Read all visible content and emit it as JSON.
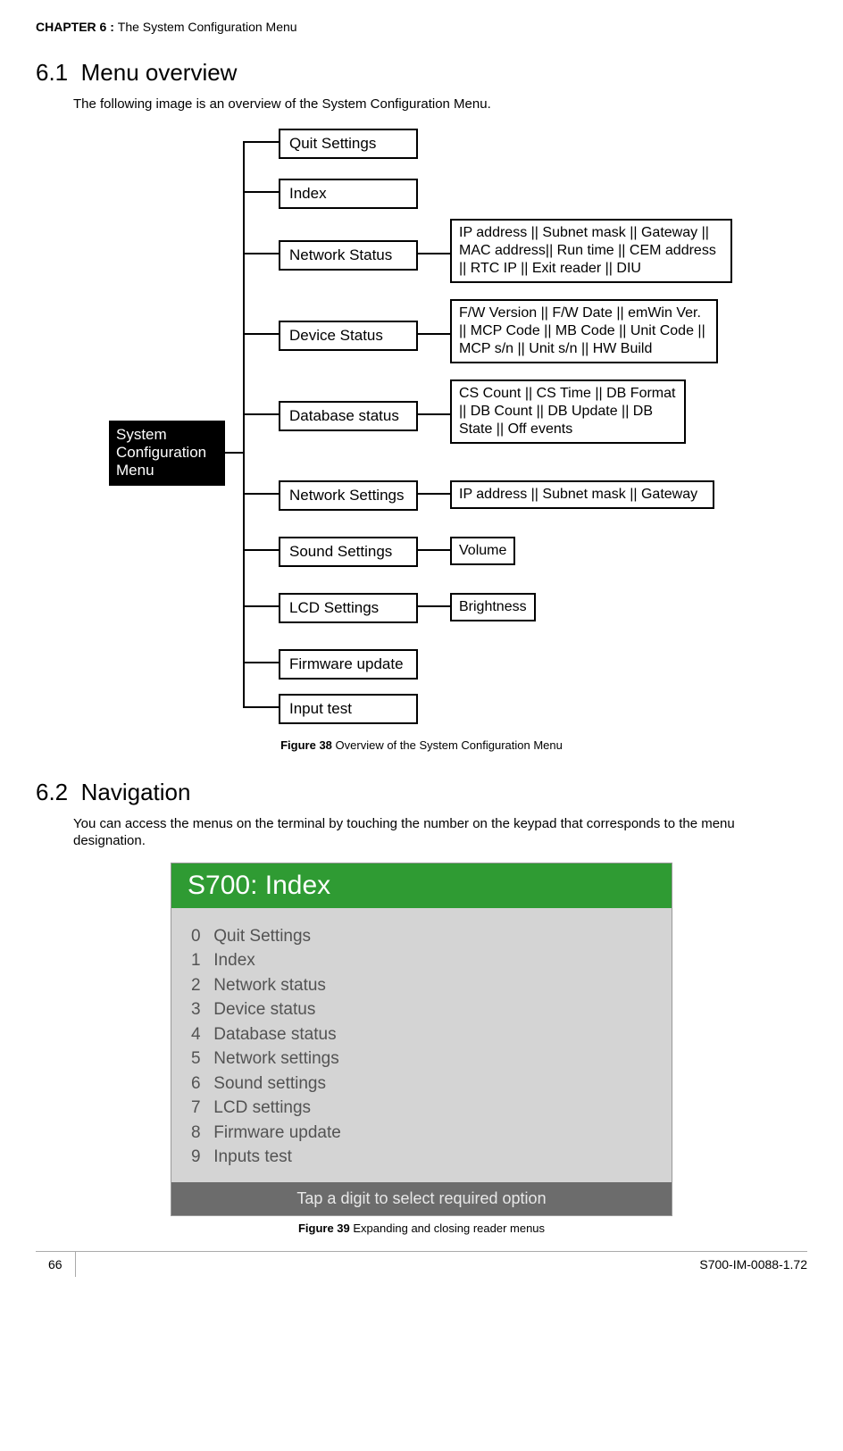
{
  "header": {
    "chapter_bold": "CHAPTER  6 : ",
    "chapter_rest": "The System Configuration Menu"
  },
  "section1": {
    "num": "6.1",
    "title": "Menu overview",
    "body": "The following image is an overview of the System Configuration Menu."
  },
  "diagram1": {
    "root": "System\nConfiguration\nMenu",
    "nodes": {
      "quit": "Quit Settings",
      "index": "Index",
      "network_status": "Network Status",
      "device_status": "Device Status",
      "database_status": "Database status",
      "network_settings": "Network Settings",
      "sound_settings": "Sound Settings",
      "lcd_settings": "LCD Settings",
      "firmware_update": "Firmware update",
      "input_test": "Input test"
    },
    "details": {
      "network_status": "IP address || Subnet mask || Gateway || MAC address|| Run time || CEM address || RTC IP || Exit reader || DIU",
      "device_status": "F/W Version || F/W Date || emWin Ver. || MCP Code || MB Code || Unit Code || MCP s/n || Unit s/n || HW Build",
      "database_status": "CS Count || CS Time || DB Format || DB Count || DB Update || DB State || Off events",
      "network_settings": "IP address || Subnet mask || Gateway",
      "sound_settings": "Volume",
      "lcd_settings": "Brightness"
    }
  },
  "fig38": {
    "bold": "Figure 38 ",
    "rest": "Overview of the System Configuration Menu"
  },
  "section2": {
    "num": "6.2",
    "title": "Navigation",
    "body": "You can access the menus on the terminal by touching the number on the keypad that corresponds to the menu designation."
  },
  "terminal": {
    "title": "S700: Index",
    "items": [
      {
        "n": "0",
        "t": "Quit Settings"
      },
      {
        "n": "1",
        "t": "Index"
      },
      {
        "n": "2",
        "t": "Network status"
      },
      {
        "n": "3",
        "t": "Device status"
      },
      {
        "n": "4",
        "t": "Database status"
      },
      {
        "n": "5",
        "t": "Network settings"
      },
      {
        "n": "6",
        "t": "Sound settings"
      },
      {
        "n": "7",
        "t": "LCD settings"
      },
      {
        "n": "8",
        "t": "Firmware update"
      },
      {
        "n": "9",
        "t": "Inputs test"
      }
    ],
    "footer": "Tap a digit to select required option"
  },
  "fig39": {
    "bold": "Figure 39 ",
    "rest": "Expanding and closing reader menus"
  },
  "footer": {
    "page": "66",
    "doc": "S700-IM-0088-1.72"
  }
}
